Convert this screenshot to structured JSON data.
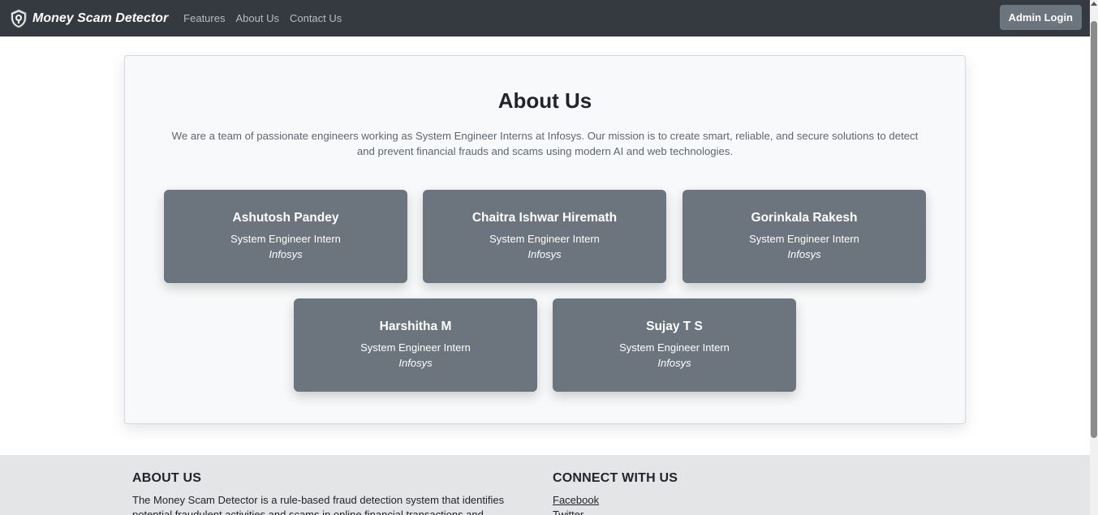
{
  "navbar": {
    "brand": "Money Scam Detector",
    "links": [
      "Features",
      "About Us",
      "Contact Us"
    ],
    "admin_button": "Admin Login"
  },
  "about": {
    "title": "About Us",
    "description": "We are a team of passionate engineers working as System Engineer Interns at Infosys. Our mission is to create smart, reliable, and secure solutions to detect and prevent financial frauds and scams using modern AI and web technologies.",
    "members": [
      {
        "name": "Ashutosh Pandey",
        "role": "System Engineer Intern",
        "company": "Infosys"
      },
      {
        "name": "Chaitra Ishwar Hiremath",
        "role": "System Engineer Intern",
        "company": "Infosys"
      },
      {
        "name": "Gorinkala Rakesh",
        "role": "System Engineer Intern",
        "company": "Infosys"
      },
      {
        "name": "Harshitha M",
        "role": "System Engineer Intern",
        "company": "Infosys"
      },
      {
        "name": "Sujay T S",
        "role": "System Engineer Intern",
        "company": "Infosys"
      }
    ]
  },
  "footer": {
    "about_heading": "ABOUT US",
    "about_text": "The Money Scam Detector is a rule-based fraud detection system that identifies potential fraudulent activities and scams in online financial transactions and",
    "connect_heading": "CONNECT WITH US",
    "links": [
      "Facebook",
      "Twitter"
    ]
  }
}
